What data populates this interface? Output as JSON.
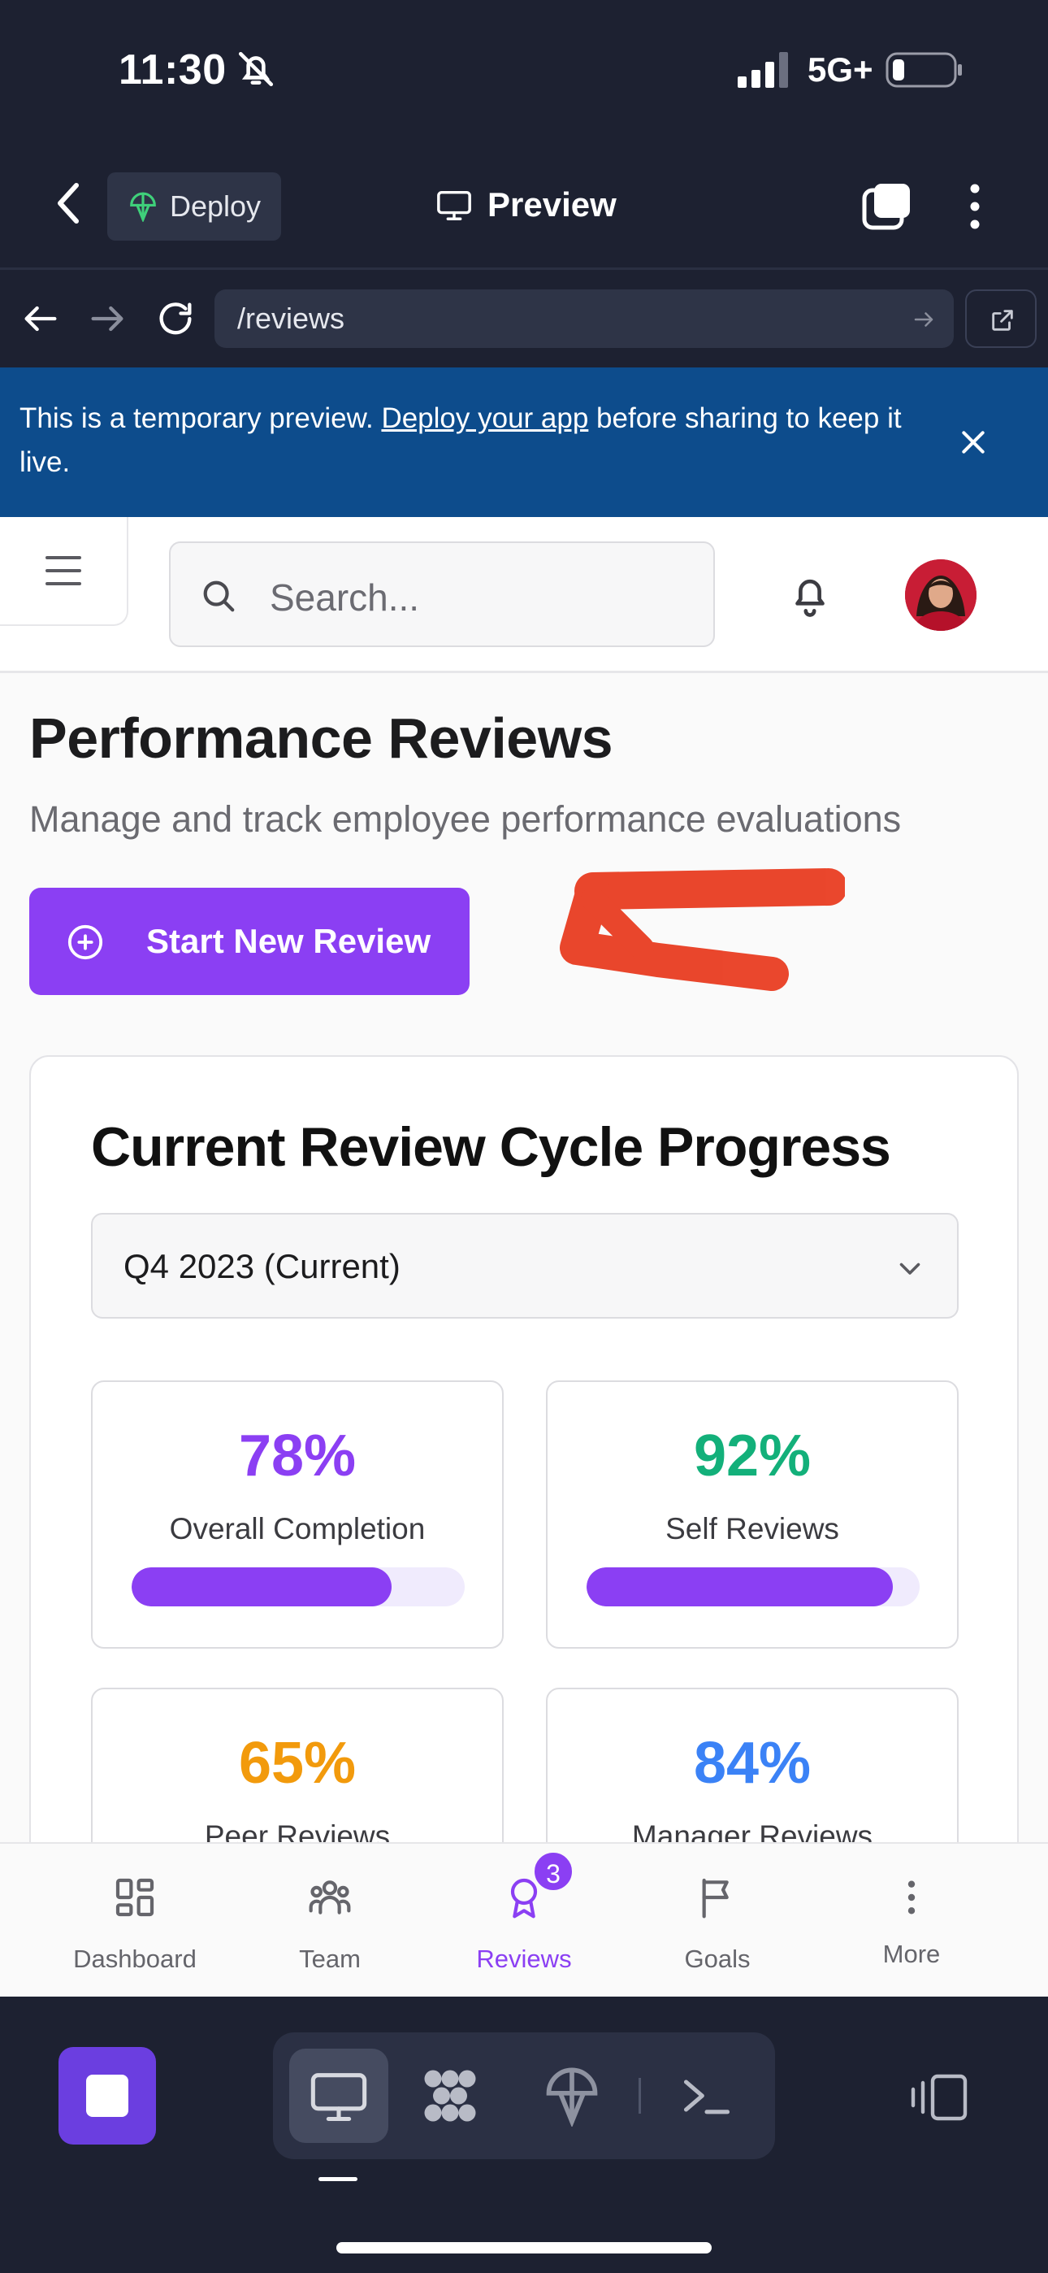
{
  "status_bar": {
    "time": "11:30",
    "network": "5G+"
  },
  "app_bar": {
    "deploy_label": "Deploy",
    "title": "Preview"
  },
  "url_bar": {
    "url": "/reviews"
  },
  "banner": {
    "text_before": "This is a temporary preview. ",
    "link_text": "Deploy your app",
    "text_after": " before sharing to keep it live."
  },
  "header": {
    "search_placeholder": "Search..."
  },
  "page": {
    "title": "Performance Reviews",
    "subtitle": "Manage and track employee performance evaluations",
    "start_button": "Start New Review"
  },
  "progress_card": {
    "title": "Current Review Cycle Progress",
    "cycle_select": "Q4 2023 (Current)",
    "stats": [
      {
        "value": "78%",
        "label": "Overall Completion",
        "fraction": 0.78,
        "color": "#8b3ff3"
      },
      {
        "value": "92%",
        "label": "Self Reviews",
        "fraction": 0.92,
        "color": "#8b3ff3",
        "value_color": "#13b07a"
      },
      {
        "value": "65%",
        "label": "Peer Reviews",
        "color": "#f29a0c"
      },
      {
        "value": "84%",
        "label": "Manager Reviews",
        "color": "#3b82f6"
      }
    ]
  },
  "bottom_nav": {
    "items": [
      {
        "label": "Dashboard",
        "icon": "dashboard-icon"
      },
      {
        "label": "Team",
        "icon": "team-icon"
      },
      {
        "label": "Reviews",
        "icon": "award-icon",
        "badge": "3",
        "active": true
      },
      {
        "label": "Goals",
        "icon": "flag-icon"
      },
      {
        "label": "More",
        "icon": "more-vertical-icon"
      }
    ]
  },
  "colors": {
    "accent": "#8b3ff3",
    "banner": "#0d4c8c",
    "chrome": "#1d2131"
  }
}
